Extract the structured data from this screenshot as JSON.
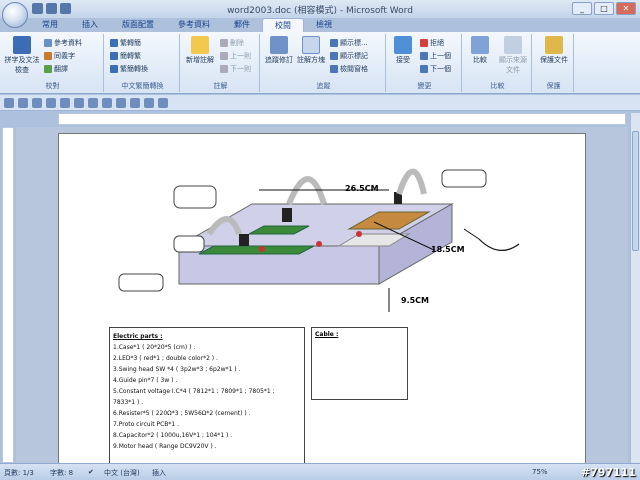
{
  "window": {
    "title": "word2003.doc (相容模式) - Microsoft Word"
  },
  "window_controls": {
    "minimize": "_",
    "maximize": "□",
    "close": "✕"
  },
  "ribbon": {
    "tabs": [
      "常用",
      "插入",
      "版面配置",
      "參考資料",
      "郵件",
      "校閱",
      "檢視"
    ],
    "active_tab": "校閱",
    "groups": {
      "proofing": {
        "label": "校對",
        "big": "拼字及文法檢查",
        "items": [
          "參考資料",
          "同義字",
          "翻譯"
        ]
      },
      "chinese": {
        "label": "中文繁簡轉換",
        "items": [
          "繁轉簡",
          "簡轉繁",
          "繁簡轉換"
        ]
      },
      "comments": {
        "label": "註解",
        "big": "新增註解",
        "items": [
          "刪除",
          "上一則",
          "下一則"
        ]
      },
      "tracking": {
        "label": "追蹤",
        "big1": "追蹤修訂",
        "big2": "註解方塊",
        "items": [
          "顯示標...",
          "顯示標記",
          "檢閱窗格"
        ]
      },
      "changes": {
        "label": "變更",
        "big": "接受",
        "items": [
          "拒絕",
          "上一個",
          "下一個"
        ]
      },
      "compare": {
        "label": "比較",
        "big1": "比較",
        "big2": "顯示來源文件"
      },
      "protect": {
        "label": "保護",
        "big": "保護文件"
      }
    }
  },
  "document": {
    "diagram_labels": {
      "length": "26.5CM",
      "width": "18.5CM",
      "height": "9.5CM"
    },
    "electric_parts": {
      "title": "Electric parts :",
      "items": [
        "1.Case*1 ( 20*20*5 (cm) ) .",
        "2.LED*3 ( red*1 ; double color*2 ) .",
        "3.Swing head SW *4 ( 3p2w*3 ; 6p2w*1 ) .",
        "4.Guide pin*7 ( 3w ) .",
        "5.Constant voltage I.C*4 ( 7812*1 ; 7809*1 ; 7805*1 ;",
        "   7833*1 ) .",
        "6.Resister*5 ( 220Ω*3 ; 5W56Ω*2 (cement) ) .",
        "7.Proto circuit PCB*1 .",
        "8.Capacitor*2 ( 1000u,16V*1 ; 104*1 ) .",
        "9.Motor head ( Range DC9V20V ) ."
      ]
    },
    "cable_box": {
      "title": "Cable :"
    }
  },
  "statusbar": {
    "page": "頁數: 1/3",
    "words": "字數: 8",
    "language": "中文 (台灣)",
    "mode": "插入",
    "zoom": "75%"
  },
  "watermark": "#797111"
}
